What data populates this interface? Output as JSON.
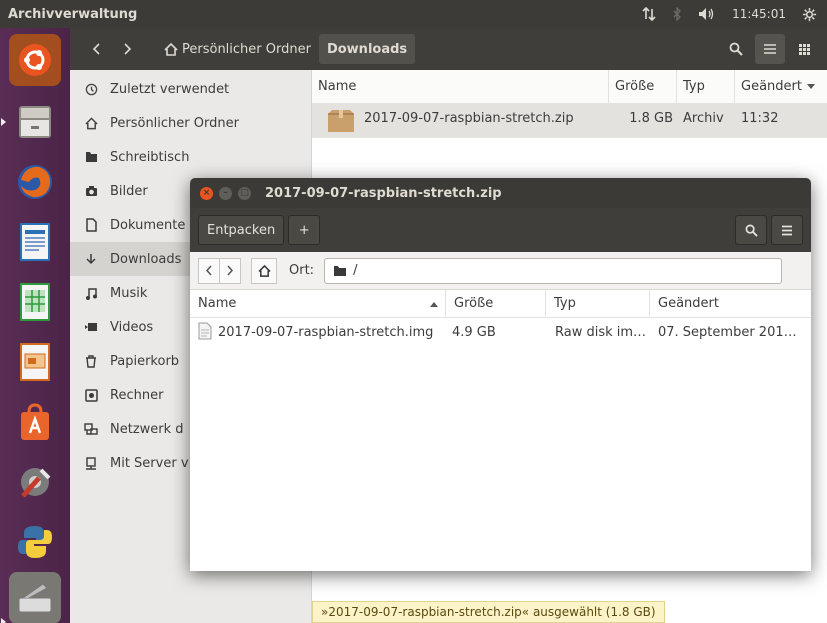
{
  "top_panel": {
    "app_title": "Archivverwaltung",
    "clock": "11:45:01"
  },
  "launcher": {
    "items": [
      "ubuntu-logo",
      "files",
      "firefox",
      "writer",
      "calc",
      "impress",
      "software-center",
      "system-settings",
      "python",
      "scanner"
    ]
  },
  "file_manager": {
    "breadcrumbs": [
      "Persönlicher Ordner",
      "Downloads"
    ],
    "sidebar": [
      {
        "label": "Zuletzt verwendet",
        "icon": "clock-icon"
      },
      {
        "label": "Persönlicher Ordner",
        "icon": "home-icon"
      },
      {
        "label": "Schreibtisch",
        "icon": "desktop-folder-icon"
      },
      {
        "label": "Bilder",
        "icon": "camera-icon"
      },
      {
        "label": "Dokumente",
        "icon": "document-icon"
      },
      {
        "label": "Downloads",
        "icon": "download-icon"
      },
      {
        "label": "Musik",
        "icon": "music-icon"
      },
      {
        "label": "Videos",
        "icon": "video-icon"
      },
      {
        "label": "Papierkorb",
        "icon": "trash-icon"
      },
      {
        "label": "Rechner",
        "icon": "computer-icon"
      },
      {
        "label": "Netzwerk d",
        "icon": "network-icon"
      },
      {
        "label": "Mit Server v",
        "icon": "server-icon"
      }
    ],
    "columns": {
      "name": "Name",
      "size": "Größe",
      "type": "Typ",
      "modified": "Geändert"
    },
    "files": [
      {
        "name": "2017-09-07-raspbian-stretch.zip",
        "size": "1.8 GB",
        "type": "Archiv",
        "modified": "11:32"
      }
    ],
    "status": "»2017-09-07-raspbian-stretch.zip« ausgewählt (1.8 GB)"
  },
  "archive_dialog": {
    "title": "2017-09-07-raspbian-stretch.zip",
    "extract_label": "Entpacken",
    "add_label": "+",
    "location_label": "Ort:",
    "location_value": "/",
    "columns": {
      "name": "Name",
      "size": "Größe",
      "type": "Typ",
      "modified": "Geändert"
    },
    "rows": [
      {
        "name": "2017-09-07-raspbian-stretch.img",
        "size": "4.9 GB",
        "type": "Raw disk im…",
        "modified": "07. September 201…"
      }
    ]
  },
  "colors": {
    "panel": "#3c3b37",
    "launcher": "#5a2d55",
    "close_button": "#e95420",
    "status_bg": "#fcf4c8"
  }
}
